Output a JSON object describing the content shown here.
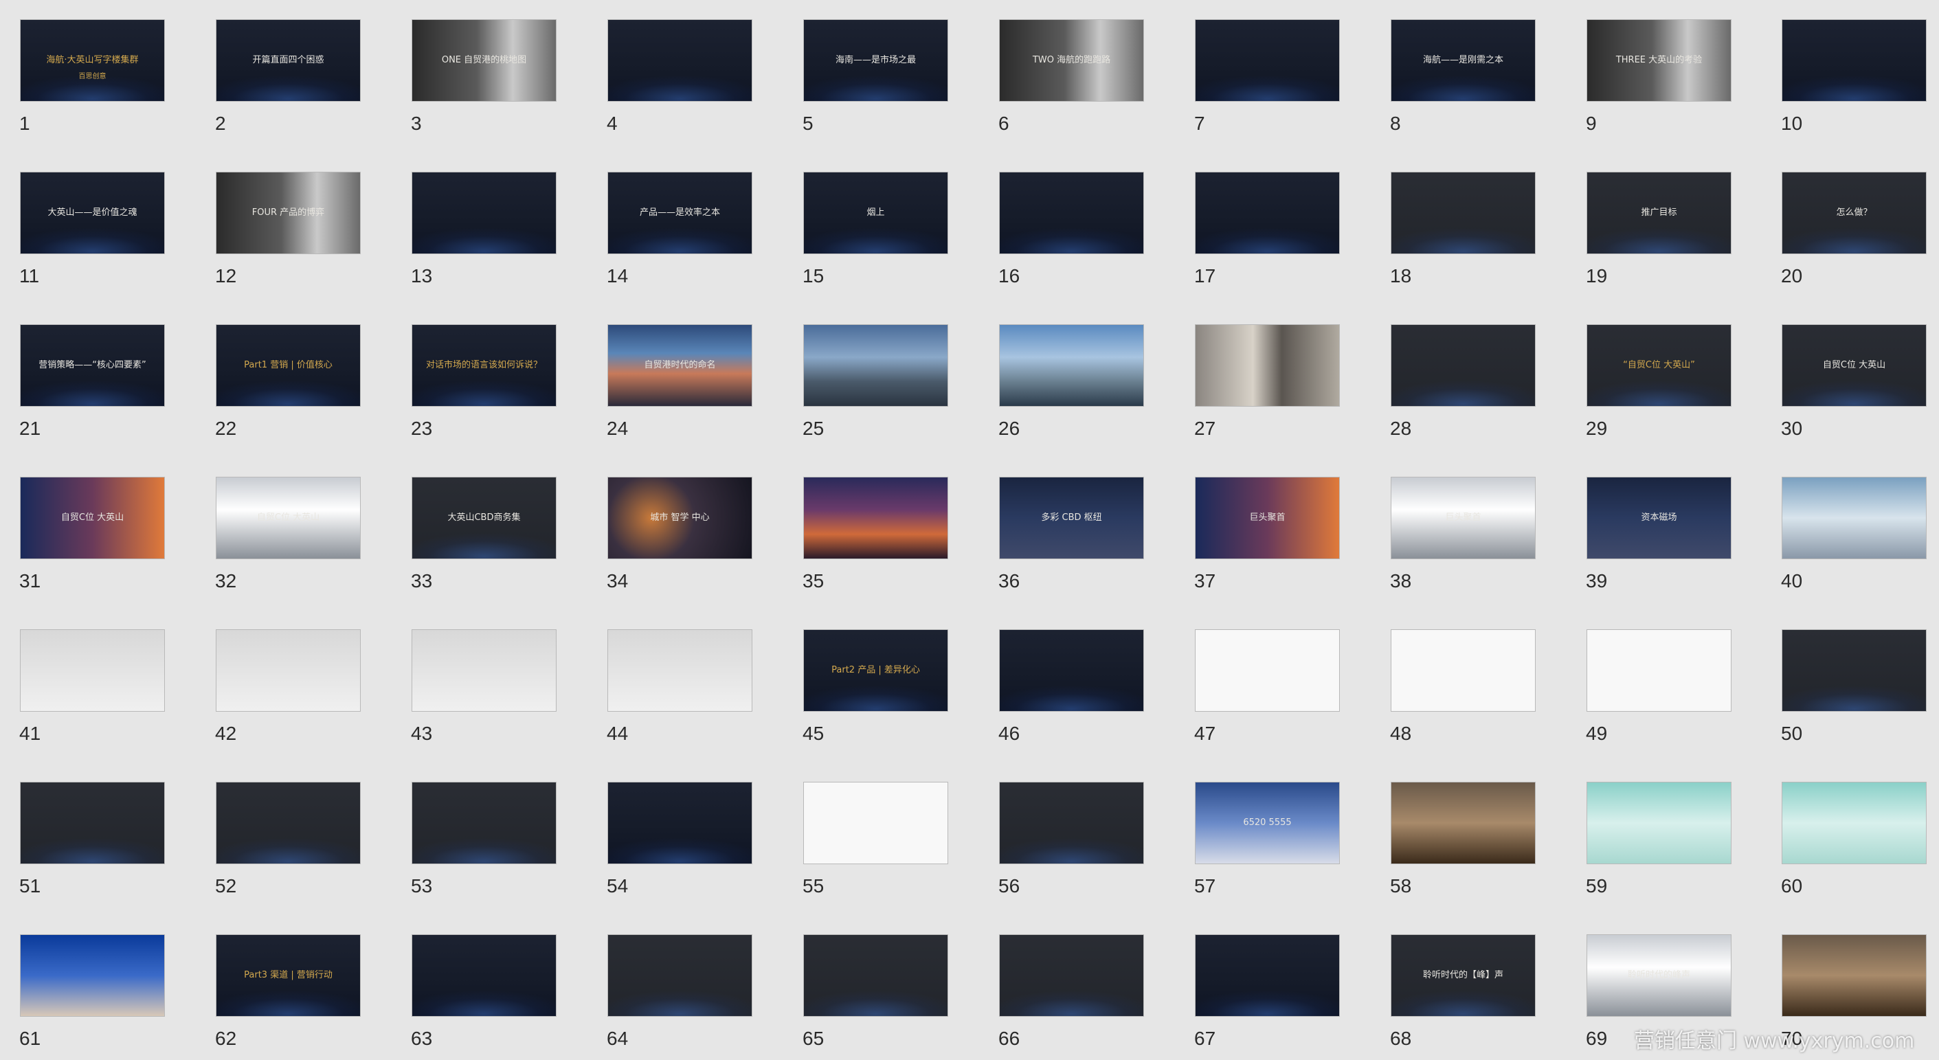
{
  "slides": [
    {
      "number": "1",
      "caption": "海航·大英山写字楼集群",
      "sub": "百思创意",
      "theme": "dark",
      "gold": true
    },
    {
      "number": "2",
      "caption": "开篇直面四个困惑",
      "theme": "dark"
    },
    {
      "number": "3",
      "caption": "ONE 自贸港的桃地图",
      "theme": "bw"
    },
    {
      "number": "4",
      "caption": "",
      "theme": "dark"
    },
    {
      "number": "5",
      "caption": "海南——是市场之最",
      "theme": "dark"
    },
    {
      "number": "6",
      "caption": "TWO 海航的跑跑路",
      "theme": "bw"
    },
    {
      "number": "7",
      "caption": "",
      "theme": "dark"
    },
    {
      "number": "8",
      "caption": "海航——是刚需之本",
      "theme": "dark"
    },
    {
      "number": "9",
      "caption": "THREE 大英山的考验",
      "theme": "bw"
    },
    {
      "number": "10",
      "caption": "",
      "theme": "dark"
    },
    {
      "number": "11",
      "caption": "大英山——是价值之魂",
      "theme": "dark"
    },
    {
      "number": "12",
      "caption": "FOUR 产品的博弈",
      "theme": "bw"
    },
    {
      "number": "13",
      "caption": "",
      "theme": "dark"
    },
    {
      "number": "14",
      "caption": "产品——是效率之本",
      "theme": "dark"
    },
    {
      "number": "15",
      "caption": "烟上",
      "theme": "dark"
    },
    {
      "number": "16",
      "caption": "",
      "theme": "dark"
    },
    {
      "number": "17",
      "caption": "",
      "theme": "dark"
    },
    {
      "number": "18",
      "caption": "",
      "theme": "gray"
    },
    {
      "number": "19",
      "caption": "推广目标",
      "theme": "gray"
    },
    {
      "number": "20",
      "caption": "怎么做？",
      "theme": "gray"
    },
    {
      "number": "21",
      "caption": "营销策略——“核心四要素”",
      "theme": "dark"
    },
    {
      "number": "22",
      "caption": "Part1 营销 | 价值核心",
      "theme": "dark",
      "gold": true
    },
    {
      "number": "23",
      "caption": "对话市场的语言该如何诉说？",
      "theme": "dark",
      "gold": true
    },
    {
      "number": "24",
      "caption": "自贸港时代的命名",
      "theme": "sky"
    },
    {
      "number": "25",
      "caption": "",
      "theme": "sky2"
    },
    {
      "number": "26",
      "caption": "",
      "theme": "sky3"
    },
    {
      "number": "27",
      "caption": "",
      "theme": "people"
    },
    {
      "number": "28",
      "caption": "",
      "theme": "gray"
    },
    {
      "number": "29",
      "caption": "“自贸C位 大英山”",
      "theme": "gray",
      "gold": true
    },
    {
      "number": "30",
      "caption": "自贸C位 大英山",
      "theme": "gray"
    },
    {
      "number": "31",
      "caption": "自贸C位 大英山",
      "theme": "ad"
    },
    {
      "number": "32",
      "caption": "自贸C位 大英山",
      "theme": "bill"
    },
    {
      "number": "33",
      "caption": "大英山CBD商务集",
      "theme": "gray"
    },
    {
      "number": "34",
      "caption": "城市 智学 中心",
      "theme": "bokeh"
    },
    {
      "number": "35",
      "caption": "",
      "theme": "night"
    },
    {
      "number": "36",
      "caption": "多彩 CBD 枢纽",
      "theme": "night2"
    },
    {
      "number": "37",
      "caption": "巨头聚首",
      "theme": "ad"
    },
    {
      "number": "38",
      "caption": "巨头聚首",
      "theme": "bill"
    },
    {
      "number": "39",
      "caption": "资本磁场",
      "theme": "night2"
    },
    {
      "number": "40",
      "caption": "",
      "theme": "glass"
    },
    {
      "number": "41",
      "caption": "",
      "theme": "light"
    },
    {
      "number": "42",
      "caption": "",
      "theme": "light"
    },
    {
      "number": "43",
      "caption": "",
      "theme": "light"
    },
    {
      "number": "44",
      "caption": "",
      "theme": "light"
    },
    {
      "number": "45",
      "caption": "Part2 产品 | 差异化心",
      "theme": "dark",
      "gold": true
    },
    {
      "number": "46",
      "caption": "",
      "theme": "dark"
    },
    {
      "number": "47",
      "caption": "",
      "theme": "white"
    },
    {
      "number": "48",
      "caption": "",
      "theme": "white"
    },
    {
      "number": "49",
      "caption": "",
      "theme": "white"
    },
    {
      "number": "50",
      "caption": "",
      "theme": "gray"
    },
    {
      "number": "51",
      "caption": "",
      "theme": "gray"
    },
    {
      "number": "52",
      "caption": "",
      "theme": "gray"
    },
    {
      "number": "53",
      "caption": "",
      "theme": "gray"
    },
    {
      "number": "54",
      "caption": "",
      "theme": "dark"
    },
    {
      "number": "55",
      "caption": "",
      "theme": "white"
    },
    {
      "number": "56",
      "caption": "",
      "theme": "gray"
    },
    {
      "number": "57",
      "caption": "6520 5555",
      "theme": "blue"
    },
    {
      "number": "58",
      "caption": "",
      "theme": "lobby"
    },
    {
      "number": "59",
      "caption": "",
      "theme": "teal"
    },
    {
      "number": "60",
      "caption": "",
      "theme": "teal"
    },
    {
      "number": "61",
      "caption": "",
      "theme": "event"
    },
    {
      "number": "62",
      "caption": "Part3 渠道 | 营销行动",
      "theme": "dark",
      "gold": true
    },
    {
      "number": "63",
      "caption": "",
      "theme": "dark"
    },
    {
      "number": "64",
      "caption": "",
      "theme": "gray"
    },
    {
      "number": "65",
      "caption": "",
      "theme": "gray"
    },
    {
      "number": "66",
      "caption": "",
      "theme": "gray"
    },
    {
      "number": "67",
      "caption": "",
      "theme": "dark"
    },
    {
      "number": "68",
      "caption": "聆听时代的【峰】声",
      "theme": "gray"
    },
    {
      "number": "69",
      "caption": "聆听时代的峰声",
      "theme": "bill"
    },
    {
      "number": "70",
      "caption": "",
      "theme": "lobby"
    }
  ],
  "watermark": "营销任意门 www.yxrym.com"
}
